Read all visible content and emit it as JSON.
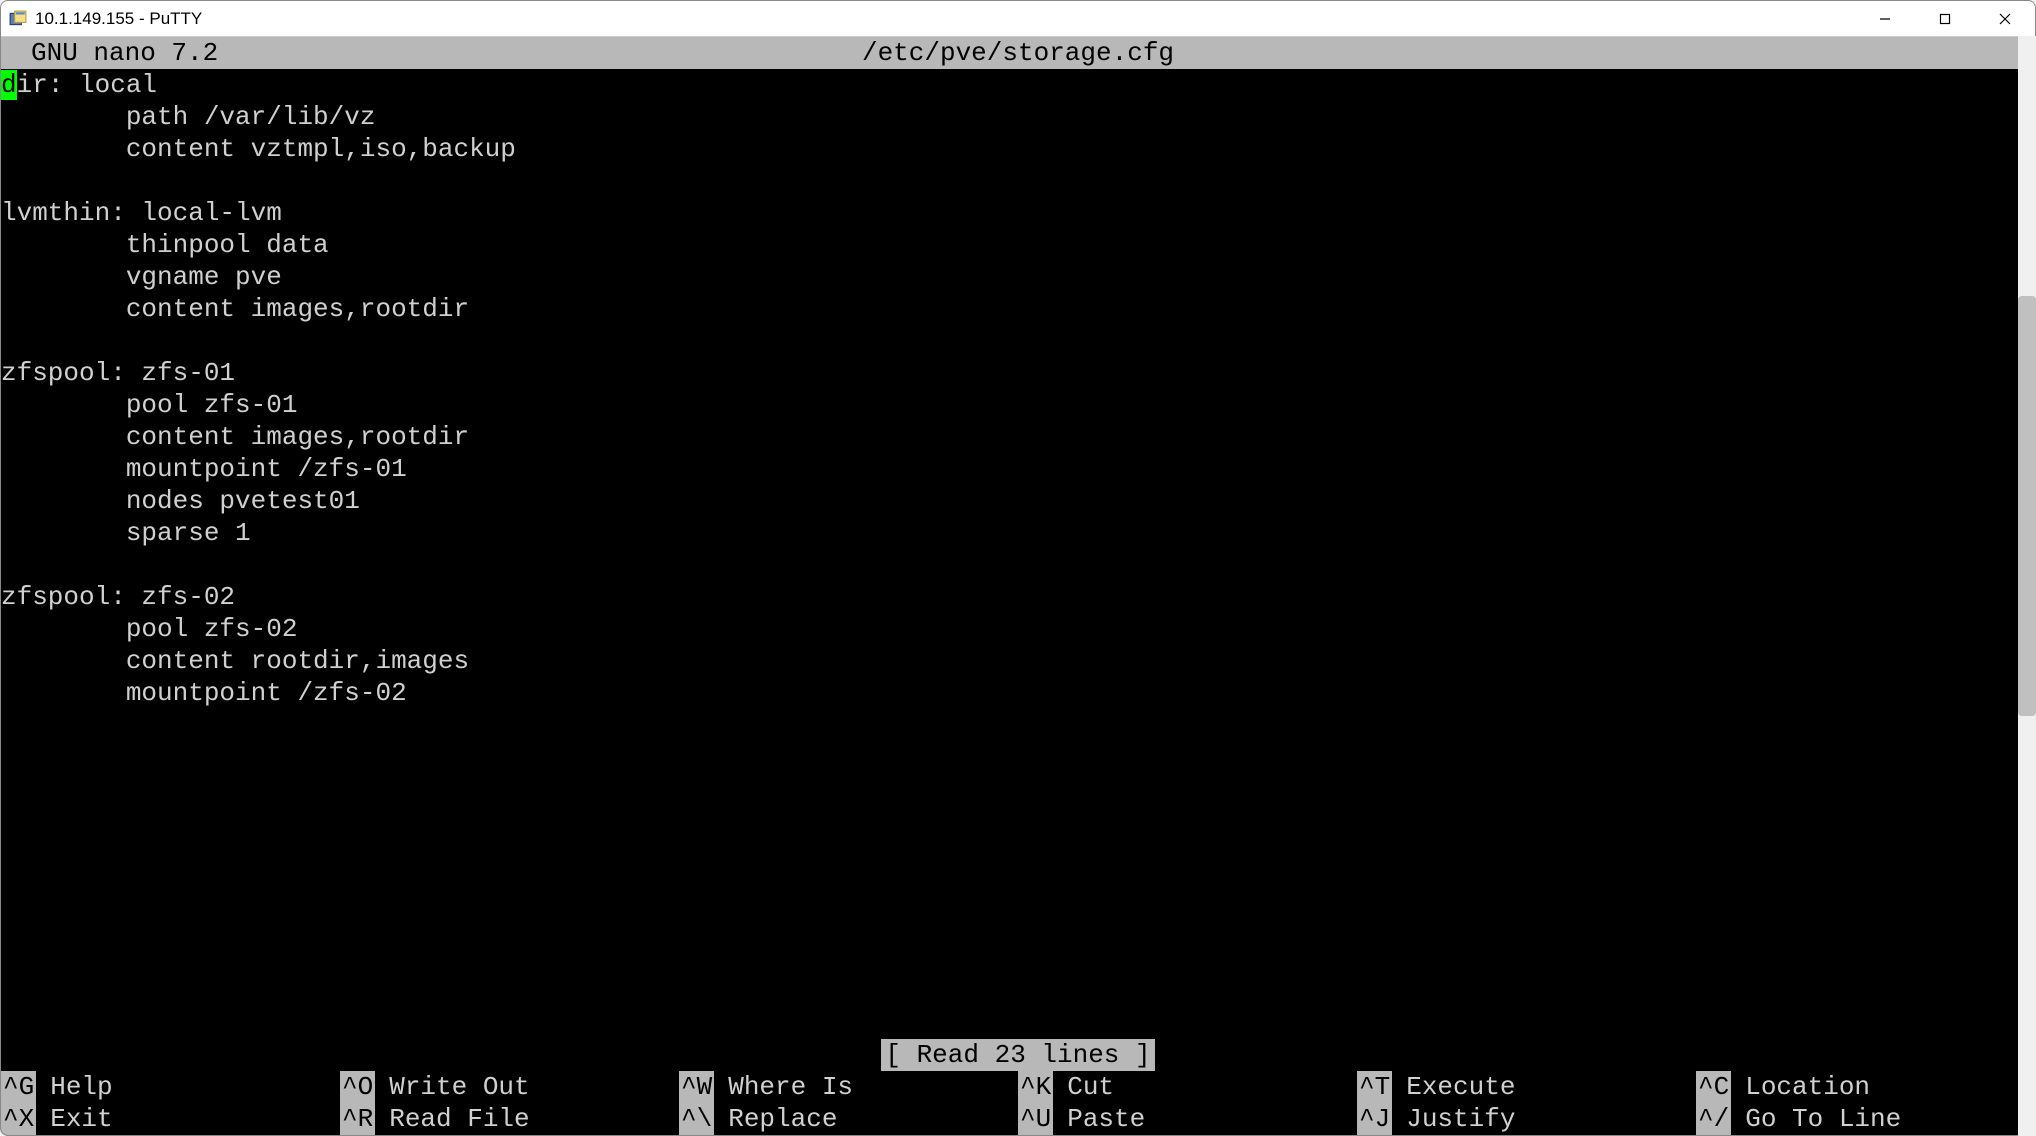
{
  "window": {
    "title": "10.1.149.155 - PuTTY"
  },
  "nano": {
    "title": "GNU nano 7.2",
    "file": "/etc/pve/storage.cfg",
    "status": "[ Read 23 lines ]"
  },
  "content": {
    "cursor_char": "d",
    "line1_rest": "ir: local",
    "line2": "        path /var/lib/vz",
    "line3": "        content vztmpl,iso,backup",
    "line4": "",
    "line5": "lvmthin: local-lvm",
    "line6": "        thinpool data",
    "line7": "        vgname pve",
    "line8": "        content images,rootdir",
    "line9": "",
    "line10": "zfspool: zfs-01",
    "line11": "        pool zfs-01",
    "line12": "        content images,rootdir",
    "line13": "        mountpoint /zfs-01",
    "line14": "        nodes pvetest01",
    "line15": "        sparse 1",
    "line16": "",
    "line17": "zfspool: zfs-02",
    "line18": "        pool zfs-02",
    "line19": "        content rootdir,images",
    "line20": "        mountpoint /zfs-02"
  },
  "help": {
    "r1c1_key": "^G",
    "r1c1_label": "Help",
    "r1c2_key": "^O",
    "r1c2_label": "Write Out",
    "r1c3_key": "^W",
    "r1c3_label": "Where Is",
    "r1c4_key": "^K",
    "r1c4_label": "Cut",
    "r1c5_key": "^T",
    "r1c5_label": "Execute",
    "r1c6_key": "^C",
    "r1c6_label": "Location",
    "r2c1_key": "^X",
    "r2c1_label": "Exit",
    "r2c2_key": "^R",
    "r2c2_label": "Read File",
    "r2c3_key": "^\\",
    "r2c3_label": "Replace",
    "r2c4_key": "^U",
    "r2c4_label": "Paste",
    "r2c5_key": "^J",
    "r2c5_label": "Justify",
    "r2c6_key": "^/",
    "r2c6_label": "Go To Line"
  }
}
